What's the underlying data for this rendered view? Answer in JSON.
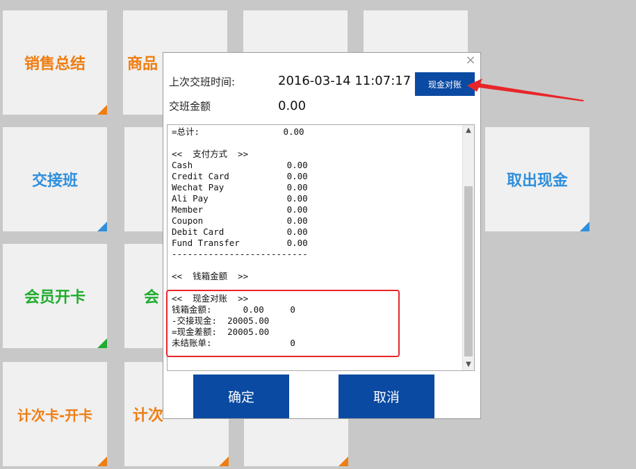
{
  "tiles": {
    "sales_summary": "销售总结",
    "product_partial": "商品",
    "handover": "交接班",
    "take_cash": "取出现金",
    "member_open_card": "会员开卡",
    "member_partial": "会",
    "count_card_open": "计次卡-开卡",
    "count_card_partial": "计次"
  },
  "dialog": {
    "last_shift_label": "上次交班时间:",
    "last_shift_value": "2016-03-14 11:07:17",
    "shift_amount_label": "交班金额",
    "shift_amount_value": "0.00",
    "cash_reconcile_button": "现金对账",
    "confirm_button": "确定",
    "cancel_button": "取消",
    "report_lines": [
      "=总计:                0.00",
      "",
      "<<  支付方式  >>",
      "Cash                  0.00",
      "Credit Card           0.00",
      "Wechat Pay            0.00",
      "Ali Pay               0.00",
      "Member                0.00",
      "Coupon                0.00",
      "Debit Card            0.00",
      "Fund Transfer         0.00",
      "--------------------------",
      "",
      "<<  钱箱金额  >>",
      "",
      "<<  现金对账  >>",
      "钱箱金额:      0.00     0",
      "-交接现金:  20005.00",
      "=现金差额:  20005.00",
      "未结账单:               0"
    ]
  },
  "colors": {
    "orange": "#ef7d12",
    "blue": "#2f8fdc",
    "green": "#20ac2e",
    "button_blue": "#0b4aa2",
    "highlight_red": "#e8262a"
  }
}
